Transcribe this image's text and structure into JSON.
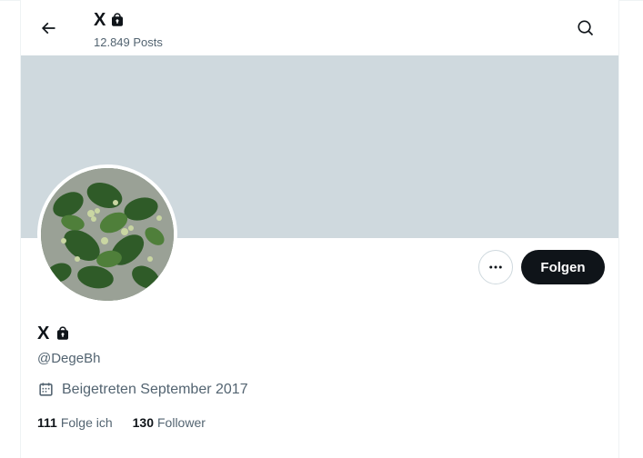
{
  "header": {
    "title": "X",
    "posts_count": "12.849 Posts"
  },
  "profile": {
    "name": "X",
    "handle": "@DegeBh",
    "joined": "Beigetreten September 2017",
    "follow_label": "Folgen",
    "following_count": "111",
    "following_label": "Folge ich",
    "followers_count": "130",
    "followers_label": "Follower"
  },
  "icons": {
    "back": "back-arrow-icon",
    "search": "search-icon",
    "lock": "lock-icon",
    "more": "more-icon",
    "calendar": "calendar-icon"
  },
  "colors": {
    "banner": "#cfd9de",
    "primary_text": "#0f1419",
    "secondary_text": "#536471",
    "follow_button": "#0f1419"
  }
}
